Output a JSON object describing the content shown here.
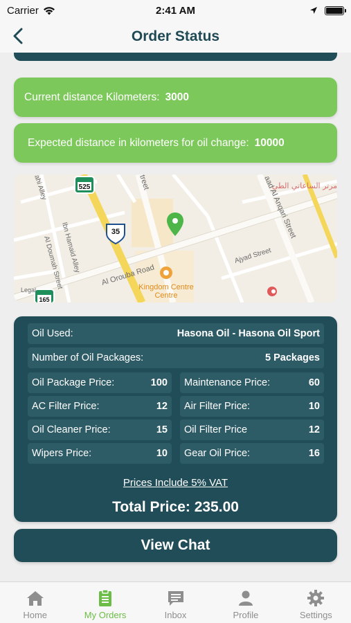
{
  "status_bar": {
    "carrier": "Carrier",
    "time": "2:41 AM"
  },
  "nav": {
    "title": "Order Status"
  },
  "distance": {
    "current_label": "Current distance Kilometers:",
    "current_value": "3000",
    "expected_label": "Expected distance in kilometers for oil change:",
    "expected_value": "10000"
  },
  "map": {
    "labels": [
      "Al Orouba Road",
      "Ibn Hamaid Alley",
      "Al Doumah Street",
      "Ajyad Street",
      "aad Al Anqari Street",
      "treet",
      "ahi Alley",
      "Kingdom Centre",
      "Legal"
    ],
    "shields": [
      "525",
      "35",
      "165"
    ],
    "arabic_label": "مرتر الساعاتي الطي"
  },
  "details": {
    "oil_used_label": "Oil Used:",
    "oil_used_value": "Hasona Oil - Hasona Oil Sport",
    "packages_label": "Number of Oil Packages:",
    "packages_value": "5 Packages",
    "prices": [
      {
        "label": "Oil Package Price:",
        "value": "100"
      },
      {
        "label": "Maintenance Price:",
        "value": "60"
      },
      {
        "label": "AC Filter Price:",
        "value": "12"
      },
      {
        "label": "Air Filter Price:",
        "value": "10"
      },
      {
        "label": "Oil Cleaner Price:",
        "value": "15"
      },
      {
        "label": "Oil Filter Price",
        "value": "12"
      },
      {
        "label": "Wipers Price:",
        "value": "10"
      },
      {
        "label": "Gear Oil Price:",
        "value": "16"
      }
    ],
    "vat_note": "Prices Include 5% VAT",
    "total": "Total Price: 235.00"
  },
  "chat_button": "View Chat",
  "tabs": [
    {
      "label": "Home",
      "icon": "home-icon"
    },
    {
      "label": "My Orders",
      "icon": "clipboard-icon"
    },
    {
      "label": "Inbox",
      "icon": "chat-bubble-icon"
    },
    {
      "label": "Profile",
      "icon": "person-icon"
    },
    {
      "label": "Settings",
      "icon": "gear-icon"
    }
  ],
  "colors": {
    "primary": "#214d58",
    "accent_green": "#7cc85a",
    "tab_active": "#6bbd45"
  }
}
